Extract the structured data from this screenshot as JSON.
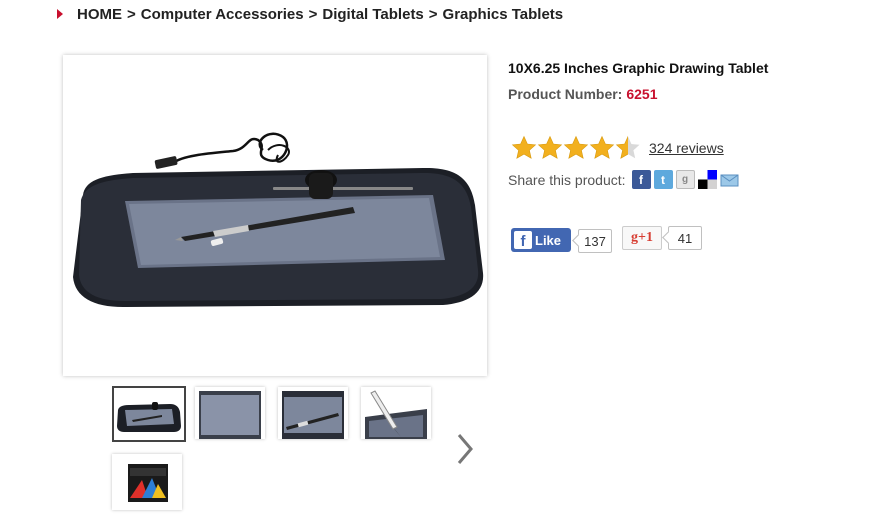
{
  "breadcrumb": {
    "items": [
      "HOME",
      "Computer Accessories",
      "Digital Tablets",
      "Graphics Tablets"
    ],
    "separator": ">"
  },
  "product": {
    "title": "10X6.25 Inches Graphic Drawing Tablet",
    "number_label": "Product Number:",
    "number": "6251",
    "rating": 4.5,
    "rating_max": 5,
    "reviews_text": "324 reviews"
  },
  "share": {
    "label": "Share this product:",
    "icons": [
      "facebook-icon",
      "twitter-icon",
      "google-bookmarks-icon",
      "delicious-icon",
      "email-icon"
    ]
  },
  "social": {
    "like_label": "Like",
    "like_count": "137",
    "gplus_label": "g+1",
    "gplus_count": "41"
  },
  "gallery": {
    "thumbnail_count": 5,
    "active_index": 0
  },
  "colors": {
    "accent_red": "#c8102e",
    "facebook_blue": "#4267b2",
    "star_gold": "#f2b01e"
  }
}
